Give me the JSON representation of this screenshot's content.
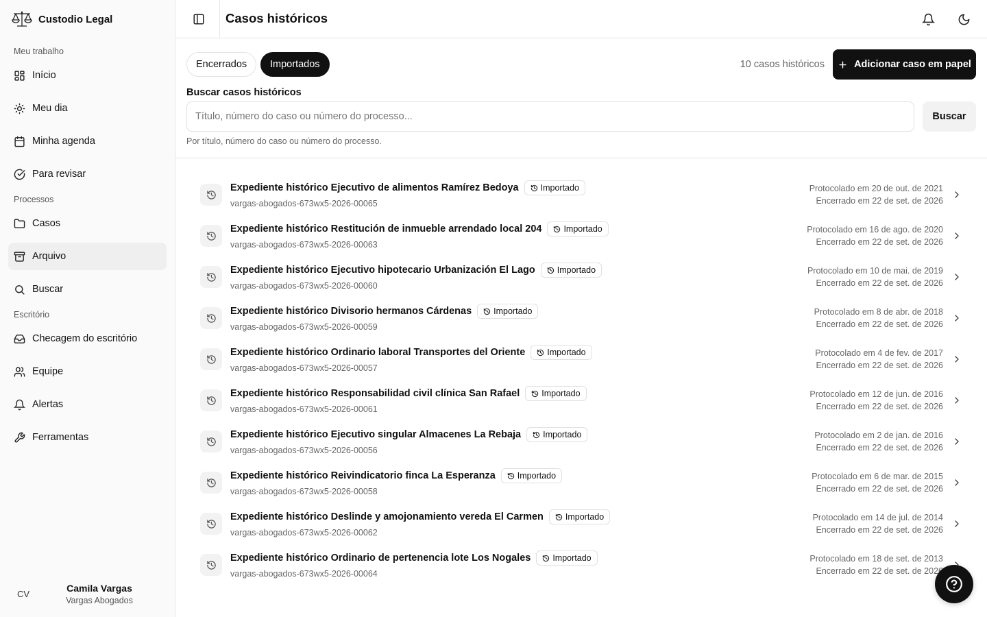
{
  "brand": {
    "name": "Custodio Legal",
    "icon": "scales-icon"
  },
  "sidebar": {
    "sections": [
      {
        "label": "Meu trabalho",
        "items": [
          {
            "label": "Início",
            "icon": "dashboard-icon"
          },
          {
            "label": "Meu dia",
            "icon": "sun-icon"
          },
          {
            "label": "Minha agenda",
            "icon": "calendar-icon"
          },
          {
            "label": "Para revisar",
            "icon": "check-circle-icon"
          }
        ]
      },
      {
        "label": "Processos",
        "items": [
          {
            "label": "Casos",
            "icon": "folder-icon"
          },
          {
            "label": "Arquivo",
            "icon": "archive-icon",
            "active": true
          },
          {
            "label": "Buscar",
            "icon": "search-icon"
          }
        ]
      },
      {
        "label": "Escritório",
        "items": [
          {
            "label": "Checagem do escritório",
            "icon": "inbox-icon"
          },
          {
            "label": "Equipe",
            "icon": "users-icon"
          },
          {
            "label": "Alertas",
            "icon": "bell-icon"
          },
          {
            "label": "Ferramentas",
            "icon": "wrench-icon"
          }
        ]
      }
    ]
  },
  "user": {
    "initials": "CV",
    "name": "Camila Vargas",
    "org": "Vargas Abogados"
  },
  "header": {
    "title": "Casos históricos"
  },
  "tabs": [
    {
      "label": "Encerrados",
      "active": false
    },
    {
      "label": "Importados",
      "active": true
    }
  ],
  "count_label": "10 casos históricos",
  "add_button_label": "Adicionar caso em papel",
  "search": {
    "label": "Buscar casos históricos",
    "placeholder": "Título, número do caso ou número do processo...",
    "value": "",
    "button_label": "Buscar",
    "hint": "Por título, número do caso ou número do processo."
  },
  "cases": [
    {
      "title": "Expediente histórico Ejecutivo de alimentos Ramírez Bedoya",
      "badge": "Importado",
      "number": "vargas-abogados-673wx5-2026-00065",
      "filed": "Protocolado em 20 de out. de 2021",
      "closed": "Encerrado em 22 de set. de 2026"
    },
    {
      "title": "Expediente histórico Restitución de inmueble arrendado local 204",
      "badge": "Importado",
      "number": "vargas-abogados-673wx5-2026-00063",
      "filed": "Protocolado em 16 de ago. de 2020",
      "closed": "Encerrado em 22 de set. de 2026"
    },
    {
      "title": "Expediente histórico Ejecutivo hipotecario Urbanización El Lago",
      "badge": "Importado",
      "number": "vargas-abogados-673wx5-2026-00060",
      "filed": "Protocolado em 10 de mai. de 2019",
      "closed": "Encerrado em 22 de set. de 2026"
    },
    {
      "title": "Expediente histórico Divisorio hermanos Cárdenas",
      "badge": "Importado",
      "number": "vargas-abogados-673wx5-2026-00059",
      "filed": "Protocolado em 8 de abr. de 2018",
      "closed": "Encerrado em 22 de set. de 2026"
    },
    {
      "title": "Expediente histórico Ordinario laboral Transportes del Oriente",
      "badge": "Importado",
      "number": "vargas-abogados-673wx5-2026-00057",
      "filed": "Protocolado em 4 de fev. de 2017",
      "closed": "Encerrado em 22 de set. de 2026"
    },
    {
      "title": "Expediente histórico Responsabilidad civil clínica San Rafael",
      "badge": "Importado",
      "number": "vargas-abogados-673wx5-2026-00061",
      "filed": "Protocolado em 12 de jun. de 2016",
      "closed": "Encerrado em 22 de set. de 2026"
    },
    {
      "title": "Expediente histórico Ejecutivo singular Almacenes La Rebaja",
      "badge": "Importado",
      "number": "vargas-abogados-673wx5-2026-00056",
      "filed": "Protocolado em 2 de jan. de 2016",
      "closed": "Encerrado em 22 de set. de 2026"
    },
    {
      "title": "Expediente histórico Reivindicatorio finca La Esperanza",
      "badge": "Importado",
      "number": "vargas-abogados-673wx5-2026-00058",
      "filed": "Protocolado em 6 de mar. de 2015",
      "closed": "Encerrado em 22 de set. de 2026"
    },
    {
      "title": "Expediente histórico Deslinde y amojonamiento vereda El Carmen",
      "badge": "Importado",
      "number": "vargas-abogados-673wx5-2026-00062",
      "filed": "Protocolado em 14 de jul. de 2014",
      "closed": "Encerrado em 22 de set. de 2026"
    },
    {
      "title": "Expediente histórico Ordinario de pertenencia lote Los Nogales",
      "badge": "Importado",
      "number": "vargas-abogados-673wx5-2026-00064",
      "filed": "Protocolado em 18 de set. de 2013",
      "closed": "Encerrado em 22 de set. de 2026"
    }
  ]
}
